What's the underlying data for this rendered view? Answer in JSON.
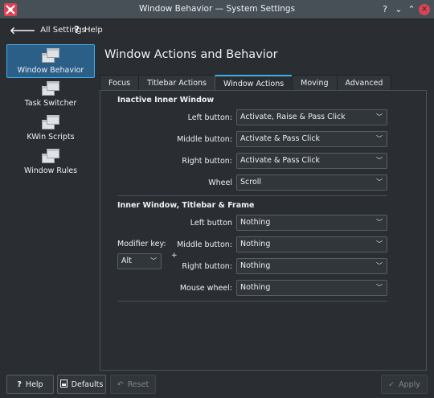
{
  "window": {
    "title": "Window Behavior — System Settings",
    "help_glyph": "?",
    "minimize_glyph": "⌄",
    "maximize_glyph": "⌃",
    "close_glyph": "✕"
  },
  "toolbar": {
    "back_icon": "arrow-left-icon",
    "back_glyph": "🡐",
    "all_settings_label": "All Settings",
    "help_icon": "question-icon",
    "help_glyph": "?",
    "help_label": "Help"
  },
  "sidebar": {
    "items": [
      {
        "label": "Window Behavior",
        "active": true
      },
      {
        "label": "Task Switcher",
        "active": false
      },
      {
        "label": "KWin Scripts",
        "active": false
      },
      {
        "label": "Window Rules",
        "active": false
      }
    ]
  },
  "page": {
    "title": "Window Actions and Behavior"
  },
  "tabs": [
    {
      "label": "Focus"
    },
    {
      "label": "Titlebar Actions"
    },
    {
      "label": "Window Actions",
      "active": true
    },
    {
      "label": "Moving"
    },
    {
      "label": "Advanced"
    }
  ],
  "inactive_inner": {
    "title": "Inactive Inner Window",
    "left_label": "Left button:",
    "left_value": "Activate, Raise & Pass Click",
    "middle_label": "Middle button:",
    "middle_value": "Activate & Pass Click",
    "right_label": "Right button:",
    "right_value": "Activate & Pass Click",
    "wheel_label": "Wheel",
    "wheel_value": "Scroll"
  },
  "inner_frame": {
    "title": "Inner Window, Titlebar & Frame",
    "modifier_label": "Modifier key:",
    "modifier_value": "Alt",
    "plus": "+",
    "left_label": "Left button",
    "left_value": "Nothing",
    "middle_label": "Middle button:",
    "middle_value": "Nothing",
    "right_label": "Right button:",
    "right_value": "Nothing",
    "wheel_label": "Mouse wheel:",
    "wheel_value": "Nothing"
  },
  "buttons": {
    "help_label": "Help",
    "help_glyph": "?",
    "defaults_label": "Defaults",
    "reset_label": "Reset",
    "reset_glyph": "↶",
    "apply_label": "Apply",
    "apply_glyph": "✓"
  },
  "colors": {
    "accent": "#3daee9",
    "close": "#da4453",
    "background": "#2a2e32"
  }
}
